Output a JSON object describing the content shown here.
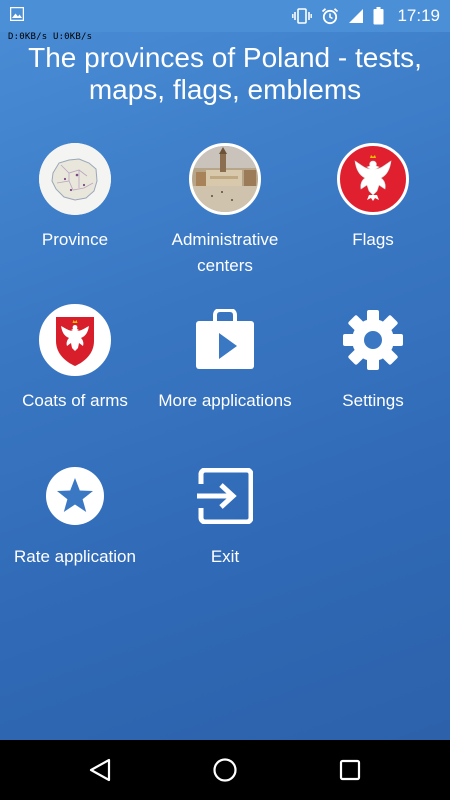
{
  "status_bar": {
    "net_speed": "D:0KB/s  U:0KB/s",
    "time": "17:19",
    "icons": [
      "image-icon",
      "vibrate-icon",
      "alarm-icon",
      "signal-icon",
      "battery-icon"
    ]
  },
  "title": "The provinces of Poland - tests, maps, flags, emblems",
  "menu": {
    "province": {
      "label": "Province",
      "icon": "map-icon"
    },
    "administrative_centers": {
      "label": "Administrative centers",
      "icon": "city-photo-icon"
    },
    "flags": {
      "label": "Flags",
      "icon": "eagle-flag-icon"
    },
    "coats_of_arms": {
      "label": "Coats of arms",
      "icon": "coat-of-arms-icon"
    },
    "more_applications": {
      "label": "More applications",
      "icon": "play-store-icon"
    },
    "settings": {
      "label": "Settings",
      "icon": "gear-icon"
    },
    "rate_application": {
      "label": "Rate application",
      "icon": "star-icon"
    },
    "exit": {
      "label": "Exit",
      "icon": "exit-icon"
    }
  },
  "nav_bar": {
    "buttons": [
      "back-icon",
      "home-icon",
      "recents-icon"
    ]
  },
  "colors": {
    "background_top": "#4a8ed6",
    "background_bottom": "#2c60a8",
    "flag_red": "#e0202e",
    "text": "#ffffff"
  }
}
